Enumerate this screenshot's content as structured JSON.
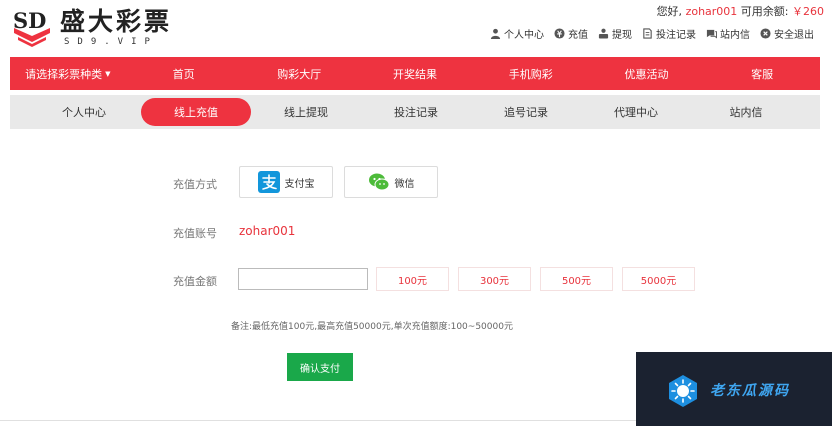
{
  "brand": {
    "mark": "SD",
    "name": "盛大彩票",
    "domain": "SD9.VIP"
  },
  "header": {
    "greeting_prefix": "您好, ",
    "username": "zohar001",
    "balance_label": " 可用余额: ",
    "balance": "￥260",
    "links": [
      {
        "label": "个人中心",
        "icon": "user-icon"
      },
      {
        "label": "充值",
        "icon": "recharge-icon"
      },
      {
        "label": "提现",
        "icon": "withdraw-icon"
      },
      {
        "label": "投注记录",
        "icon": "record-icon"
      },
      {
        "label": "站内信",
        "icon": "message-icon"
      },
      {
        "label": "安全退出",
        "icon": "logout-icon"
      }
    ]
  },
  "main_nav": {
    "items": [
      {
        "label": "请选择彩票种类"
      },
      {
        "label": "首页"
      },
      {
        "label": "购彩大厅"
      },
      {
        "label": "开奖结果"
      },
      {
        "label": "手机购彩"
      },
      {
        "label": "优惠活动"
      },
      {
        "label": "客服"
      }
    ]
  },
  "sub_nav": {
    "items": [
      {
        "label": "个人中心"
      },
      {
        "label": "线上充值"
      },
      {
        "label": "线上提现"
      },
      {
        "label": "投注记录"
      },
      {
        "label": "追号记录"
      },
      {
        "label": "代理中心"
      },
      {
        "label": "站内信"
      }
    ],
    "active_index": 1
  },
  "recharge": {
    "method_label": "充值方式",
    "methods": [
      {
        "label": "支付宝",
        "icon": "alipay-icon"
      },
      {
        "label": "微信",
        "icon": "wechat-icon"
      }
    ],
    "account_label": "充值账号",
    "account_value": "zohar001",
    "amount_label": "充值金额",
    "amount_value": "",
    "presets": [
      "100元",
      "300元",
      "500元",
      "5000元"
    ],
    "note": "备注:最低充值100元,最高充值50000元,单次充值额度:100~50000元",
    "confirm_label": "确认支付"
  },
  "watermark": {
    "text": "老东瓜源码",
    "icon": "sun-icon"
  },
  "colors": {
    "brand_red": "#ee3340",
    "confirm_green": "#1aa84a",
    "subnav_bg": "#e9e9e9",
    "alipay_blue": "#1296db",
    "wechat_green": "#4dbb3a"
  }
}
